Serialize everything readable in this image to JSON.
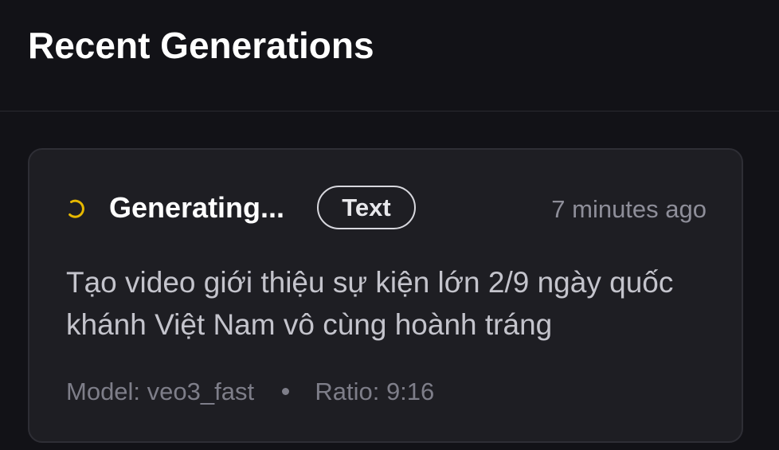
{
  "header": {
    "title": "Recent Generations"
  },
  "generation": {
    "status": "Generating...",
    "status_icon": "spinner-icon",
    "status_color": "#e6b800",
    "type_badge": "Text",
    "timestamp": "7 minutes ago",
    "prompt": "Tạo video giới thiệu sự kiện lớn 2/9 ngày quốc khánh Việt Nam vô cùng hoành tráng",
    "model": "Model: veo3_fast",
    "ratio": "Ratio: 9:16"
  }
}
